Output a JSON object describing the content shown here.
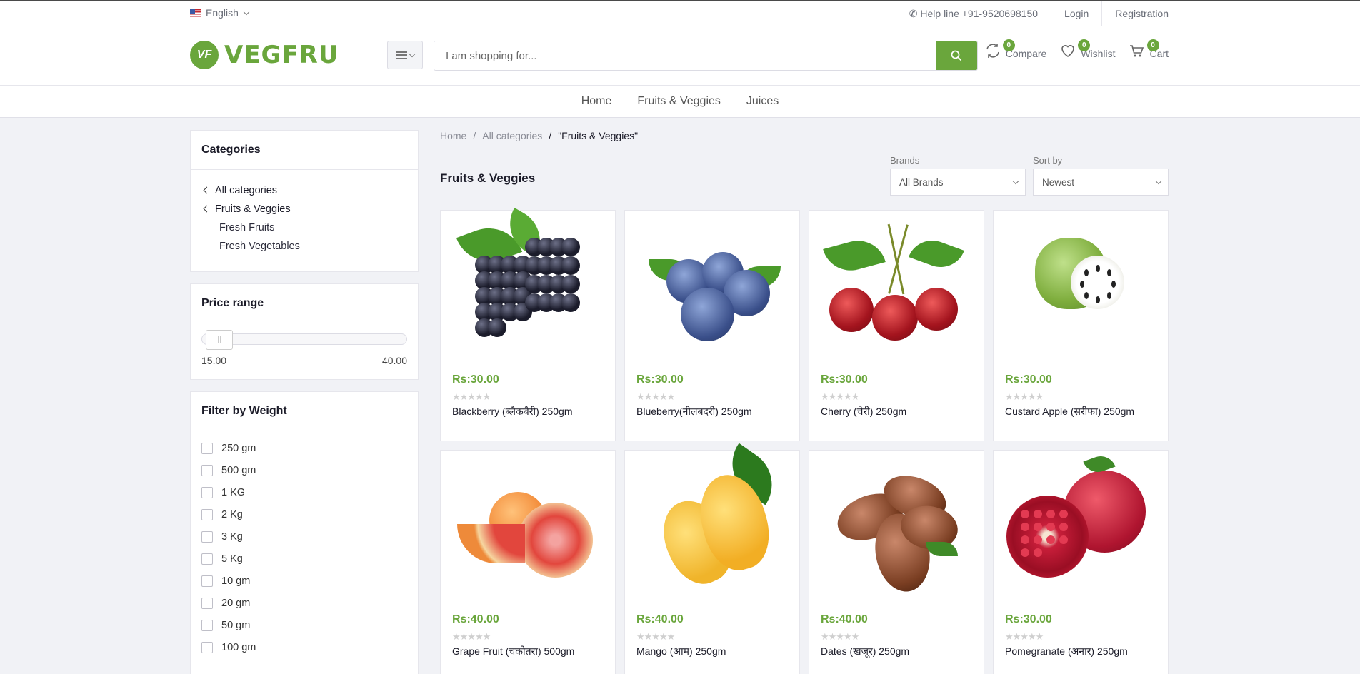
{
  "topbar": {
    "language": "English",
    "helpline": "Help line +91-9520698150",
    "login": "Login",
    "registration": "Registration"
  },
  "header": {
    "logo_text": "VEGFRU",
    "logo_mark": "VF",
    "search_placeholder": "I am shopping for...",
    "compare": {
      "label": "Compare",
      "count": "0"
    },
    "wishlist": {
      "label": "Wishlist",
      "count": "0"
    },
    "cart": {
      "label": "Cart",
      "count": "0"
    }
  },
  "nav": [
    "Home",
    "Fruits & Veggies",
    "Juices"
  ],
  "sidebar": {
    "categories_title": "Categories",
    "categories": [
      {
        "label": "All categories",
        "level": 0
      },
      {
        "label": "Fruits & Veggies",
        "level": 0
      },
      {
        "label": "Fresh Fruits",
        "level": 1
      },
      {
        "label": "Fresh Vegetables",
        "level": 1
      }
    ],
    "price_title": "Price range",
    "price_min": "15.00",
    "price_max": "40.00",
    "weight_title": "Filter by Weight",
    "weights": [
      "250 gm",
      "500 gm",
      "1 KG",
      "2 Kg",
      "3 Kg",
      "5 Kg",
      "10 gm",
      "20 gm",
      "50 gm",
      "100 gm"
    ]
  },
  "breadcrumb": [
    "Home",
    "All categories",
    "\"Fruits & Veggies\""
  ],
  "page_title": "Fruits & Veggies",
  "filters": {
    "brands_label": "Brands",
    "brands_value": "All Brands",
    "sort_label": "Sort by",
    "sort_value": "Newest"
  },
  "products": [
    {
      "price": "Rs:30.00",
      "name": "Blackberry (ब्लैकबैरी) 250gm",
      "rating": 0,
      "image": "blackberry"
    },
    {
      "price": "Rs:30.00",
      "name": "Blueberry(नीलबदरी) 250gm",
      "rating": 0,
      "image": "blueberry"
    },
    {
      "price": "Rs:30.00",
      "name": "Cherry (चेरी) 250gm",
      "rating": 0,
      "image": "cherry"
    },
    {
      "price": "Rs:30.00",
      "name": "Custard Apple (सरीफा) 250gm",
      "rating": 0,
      "image": "custard-apple"
    },
    {
      "price": "Rs:40.00",
      "name": "Grape Fruit (चकोतरा) 500gm",
      "rating": 0,
      "image": "grapefruit"
    },
    {
      "price": "Rs:40.00",
      "name": "Mango (आम) 250gm",
      "rating": 0,
      "image": "mango"
    },
    {
      "price": "Rs:40.00",
      "name": "Dates (खजूर) 250gm",
      "rating": 0,
      "image": "dates"
    },
    {
      "price": "Rs:30.00",
      "name": "Pomegranate (अनार) 250gm",
      "rating": 0,
      "image": "pomegranate"
    }
  ],
  "colors": {
    "brand_green": "#6aa63c",
    "bg": "#f1f2f6"
  }
}
